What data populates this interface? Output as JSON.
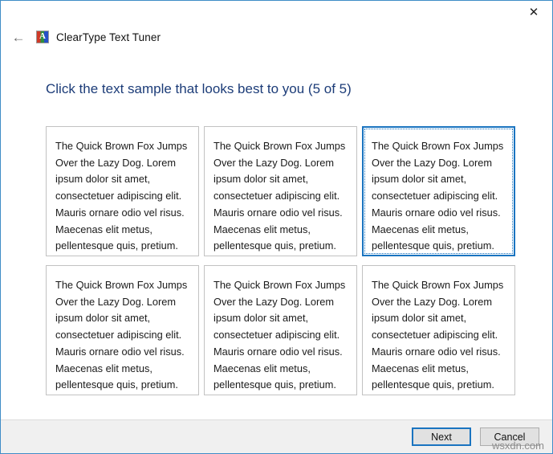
{
  "window": {
    "close_label": "✕",
    "back_label": "←",
    "app_icon_glyph": "A",
    "app_icon_name": "cleartype-icon",
    "title": "ClearType Text Tuner",
    "border_color": "#3f8dc7"
  },
  "content": {
    "heading": "Click the text sample that looks best to you (5 of 5)",
    "heading_color": "#1c3c78",
    "sample_text": "The Quick Brown Fox Jumps Over the Lazy Dog. Lorem ipsum dolor sit amet, consectetuer adipiscing elit. Mauris ornare odio vel risus. Maecenas elit metus, pellentesque quis, pretium.",
    "samples": [
      {
        "index": 1,
        "text": "The Quick Brown Fox Jumps Over the Lazy Dog. Lorem ipsum dolor sit amet, consectetuer adipiscing elit. Mauris ornare odio vel risus. Maecenas elit metus, pellentesque quis, pretium.",
        "selected": false
      },
      {
        "index": 2,
        "text": "The Quick Brown Fox Jumps Over the Lazy Dog. Lorem ipsum dolor sit amet, consectetuer adipiscing elit. Mauris ornare odio vel risus. Maecenas elit metus, pellentesque quis, pretium.",
        "selected": false
      },
      {
        "index": 3,
        "text": "The Quick Brown Fox Jumps Over the Lazy Dog. Lorem ipsum dolor sit amet, consectetuer adipiscing elit. Mauris ornare odio vel risus. Maecenas elit metus, pellentesque quis, pretium.",
        "selected": true
      },
      {
        "index": 4,
        "text": "The Quick Brown Fox Jumps Over the Lazy Dog. Lorem ipsum dolor sit amet, consectetuer adipiscing elit. Mauris ornare odio vel risus. Maecenas elit metus, pellentesque quis, pretium.",
        "selected": false
      },
      {
        "index": 5,
        "text": "The Quick Brown Fox Jumps Over the Lazy Dog. Lorem ipsum dolor sit amet, consectetuer adipiscing elit. Mauris ornare odio vel risus. Maecenas elit metus, pellentesque quis, pretium.",
        "selected": false
      },
      {
        "index": 6,
        "text": "The Quick Brown Fox Jumps Over the Lazy Dog. Lorem ipsum dolor sit amet, consectetuer adipiscing elit. Mauris ornare odio vel risus. Maecenas elit metus, pellentesque quis, pretium.",
        "selected": false
      }
    ],
    "selected_index": 3
  },
  "footer": {
    "next_label": "Next",
    "cancel_label": "Cancel",
    "accent_color": "#1a74c0"
  },
  "watermark": {
    "text": "wsxdn.com"
  }
}
